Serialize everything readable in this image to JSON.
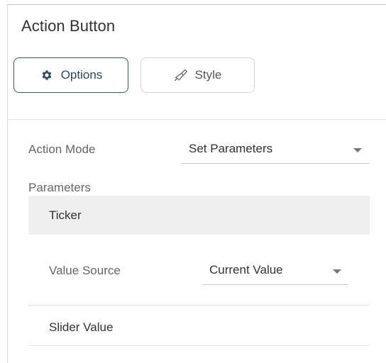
{
  "panel": {
    "title": "Action Button"
  },
  "tabs": [
    {
      "label": "Options",
      "icon": "gear-icon",
      "active": true
    },
    {
      "label": "Style",
      "icon": "paintbrush-icon",
      "active": false
    }
  ],
  "action_mode": {
    "label": "Action Mode",
    "value": "Set Parameters"
  },
  "parameters": {
    "label": "Parameters",
    "items": [
      {
        "name": "Ticker",
        "value_source_label": "Value Source",
        "value_source_value": "Current Value"
      }
    ],
    "slider_value_label": "Slider Value"
  },
  "colors": {
    "accent": "#2f5c73",
    "row_highlight": "#efefef",
    "divider": "#e3e3e3"
  }
}
